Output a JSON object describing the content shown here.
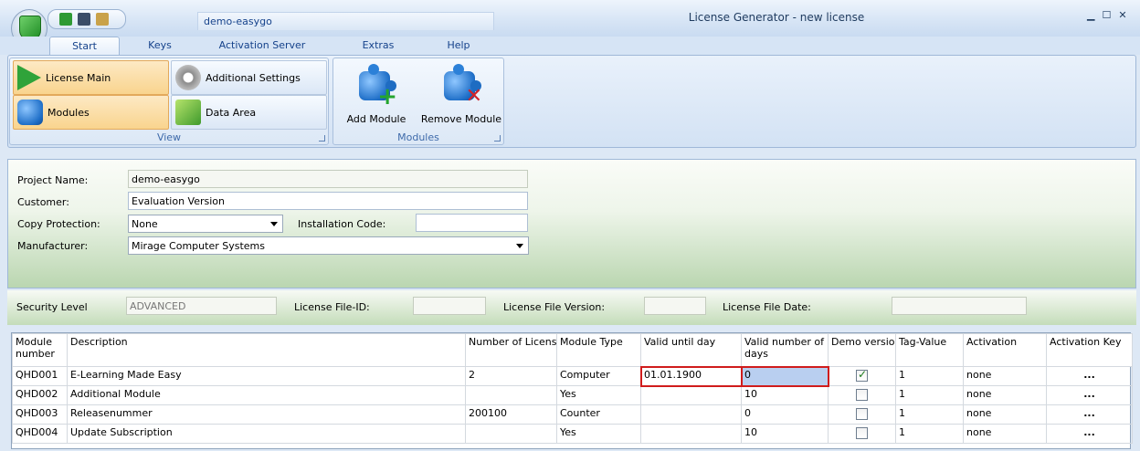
{
  "window": {
    "title": "License Generator - new license",
    "doc_tab": "demo-easygo",
    "controls": [
      "▁",
      "☐",
      "✕"
    ]
  },
  "ribbon": {
    "tabs": [
      {
        "label": "Start"
      },
      {
        "label": "Keys"
      },
      {
        "label": "Activation Server"
      },
      {
        "label": "Extras"
      },
      {
        "label": "Help"
      }
    ],
    "view_group": {
      "label": "View",
      "buttons": {
        "license_main": "License Main",
        "additional_settings": "Additional Settings",
        "modules": "Modules",
        "data_area": "Data Area"
      }
    },
    "modules_group": {
      "label": "Modules",
      "add_module": "Add Module",
      "remove_module": "Remove Module"
    }
  },
  "form": {
    "project_name_label": "Project Name:",
    "project_name": "demo-easygo",
    "customer_label": "Customer:",
    "customer": "Evaluation Version",
    "copy_protection_label": "Copy Protection:",
    "copy_protection": "None",
    "installation_code_label": "Installation Code:",
    "installation_code": "",
    "manufacturer_label": "Manufacturer:",
    "manufacturer": "Mirage Computer Systems"
  },
  "security": {
    "security_level_label": "Security Level",
    "security_level": "ADVANCED",
    "license_file_id_label": "License File-ID:",
    "license_file_id": "",
    "license_file_version_label": "License File Version:",
    "license_file_version": "",
    "license_file_date_label": "License File Date:",
    "license_file_date": ""
  },
  "grid": {
    "columns": [
      "Module number",
      "Description",
      "Number of Licenses",
      "Module Type",
      "Valid until day",
      "Valid number of days",
      "Demo version",
      "Tag-Value",
      "Activation",
      "Activation Key"
    ],
    "rows": [
      {
        "number": "QHD001",
        "description": "E-Learning Made Easy",
        "licenses": "2",
        "type": "Computer",
        "valid_until": "01.01.1900",
        "valid_days": "0",
        "demo": true,
        "tag": "1",
        "activation": "none",
        "key": "..."
      },
      {
        "number": "QHD002",
        "description": "Additional Module",
        "licenses": "",
        "type": "Yes",
        "valid_until": "",
        "valid_days": "10",
        "demo": false,
        "tag": "1",
        "activation": "none",
        "key": "..."
      },
      {
        "number": "QHD003",
        "description": "Releasenummer",
        "licenses": "200100",
        "type": "Counter",
        "valid_until": "",
        "valid_days": "0",
        "demo": false,
        "tag": "1",
        "activation": "none",
        "key": "..."
      },
      {
        "number": "QHD004",
        "description": "Update Subscription",
        "licenses": "",
        "type": "Yes",
        "valid_until": "",
        "valid_days": "10",
        "demo": false,
        "tag": "1",
        "activation": "none",
        "key": "..."
      }
    ]
  }
}
